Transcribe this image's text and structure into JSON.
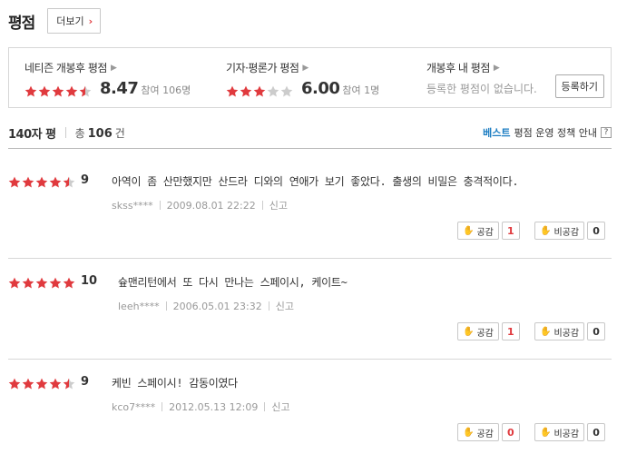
{
  "header": {
    "title": "평점",
    "more_label": "더보기"
  },
  "summary": {
    "netizen": {
      "label": "네티즌 개봉후 평점",
      "rating": 4.5,
      "score": "8.47",
      "count": "참여 106명"
    },
    "critic": {
      "label": "기자·평론가 평점",
      "rating": 3.0,
      "score": "6.00",
      "count": "참여 1명"
    },
    "mine": {
      "label": "개봉후 내 평점",
      "note": "등록한 평점이 없습니다.",
      "register_label": "등록하기"
    }
  },
  "list_header": {
    "title": "140자 평",
    "total_prefix": "총",
    "total": "106",
    "total_suffix": "건",
    "best": "베스트",
    "policy": "평점 운영 정책 안내",
    "help": "?"
  },
  "vote_labels": {
    "agree": "공감",
    "disagree": "비공감"
  },
  "report_label": "신고",
  "reviews": [
    {
      "rating": 4.5,
      "score": "9",
      "text": "아역이 좀 산만했지만 산드라 디와의 연애가 보기 좋았다. 출생의 비밀은 충격적이다.",
      "user": "skss****",
      "date": "2009.08.01 22:22",
      "agree": "1",
      "disagree": "0"
    },
    {
      "rating": 5,
      "score": "10",
      "text": "슢맨리턴에서 또 다시 만나는 스페이시, 케이트~",
      "user": "leeh****",
      "date": "2006.05.01 23:32",
      "agree": "1",
      "disagree": "0"
    },
    {
      "rating": 4.5,
      "score": "9",
      "text": "케빈 스페이시! 감동이였다",
      "user": "kco7****",
      "date": "2012.05.13 12:09",
      "agree": "0",
      "disagree": "0"
    }
  ],
  "colors": {
    "star": "#e03a3e",
    "star_empty": "#cccccc",
    "accent_blue": "#1a7cc2"
  }
}
